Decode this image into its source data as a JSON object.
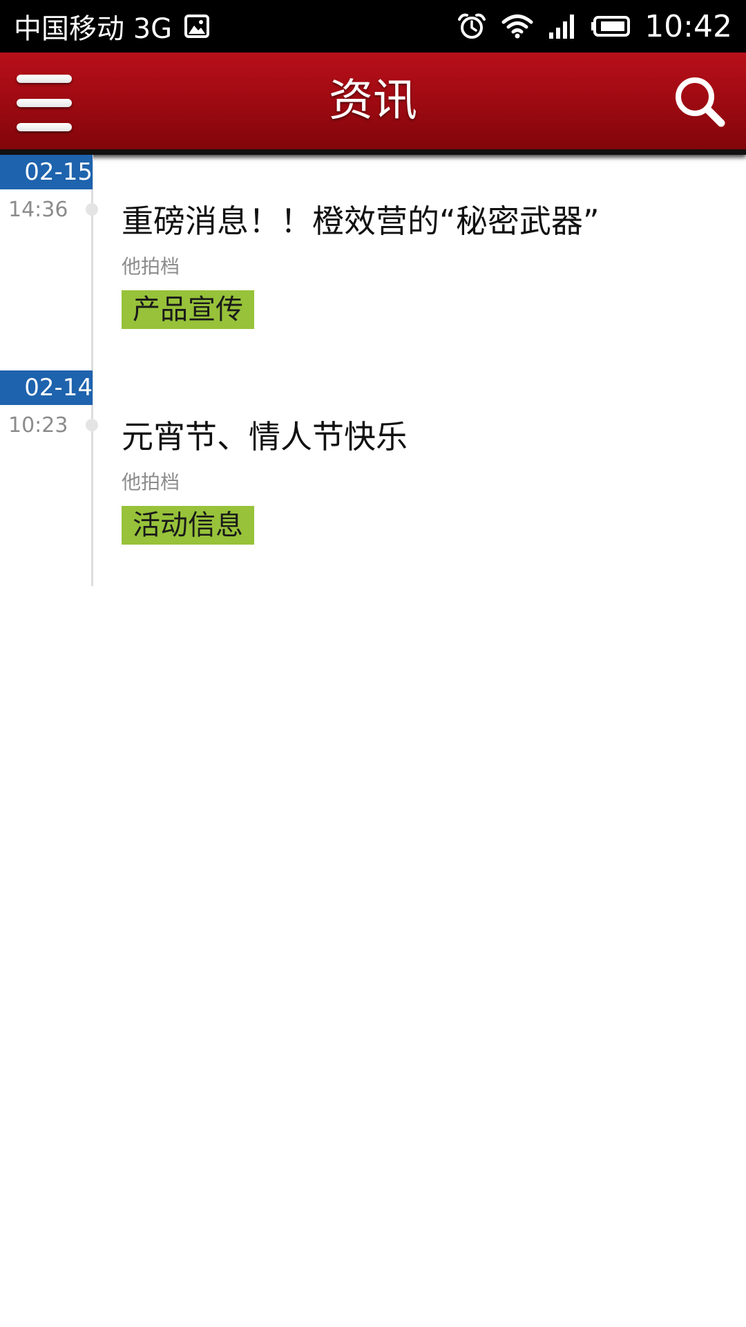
{
  "status_bar": {
    "carrier": "中国移动 3G",
    "time": "10:42",
    "icons": [
      "image-icon",
      "alarm-icon",
      "wifi-icon",
      "signal-icon",
      "battery-icon"
    ]
  },
  "app_bar": {
    "title": "资讯",
    "left_icon": "menu-icon",
    "right_icon": "search-icon"
  },
  "colors": {
    "app_bar": "#a00a12",
    "date_badge": "#1e63ad",
    "tag": "#97c23a"
  },
  "timeline": [
    {
      "date": "02-15",
      "time": "14:36",
      "title": "重磅消息！！橙效营的“秘密武器”",
      "author": "他拍档",
      "tag": "产品宣传"
    },
    {
      "date": "02-14",
      "time": "10:23",
      "title": "元宵节、情人节快乐",
      "author": "他拍档",
      "tag": "活动信息"
    }
  ]
}
